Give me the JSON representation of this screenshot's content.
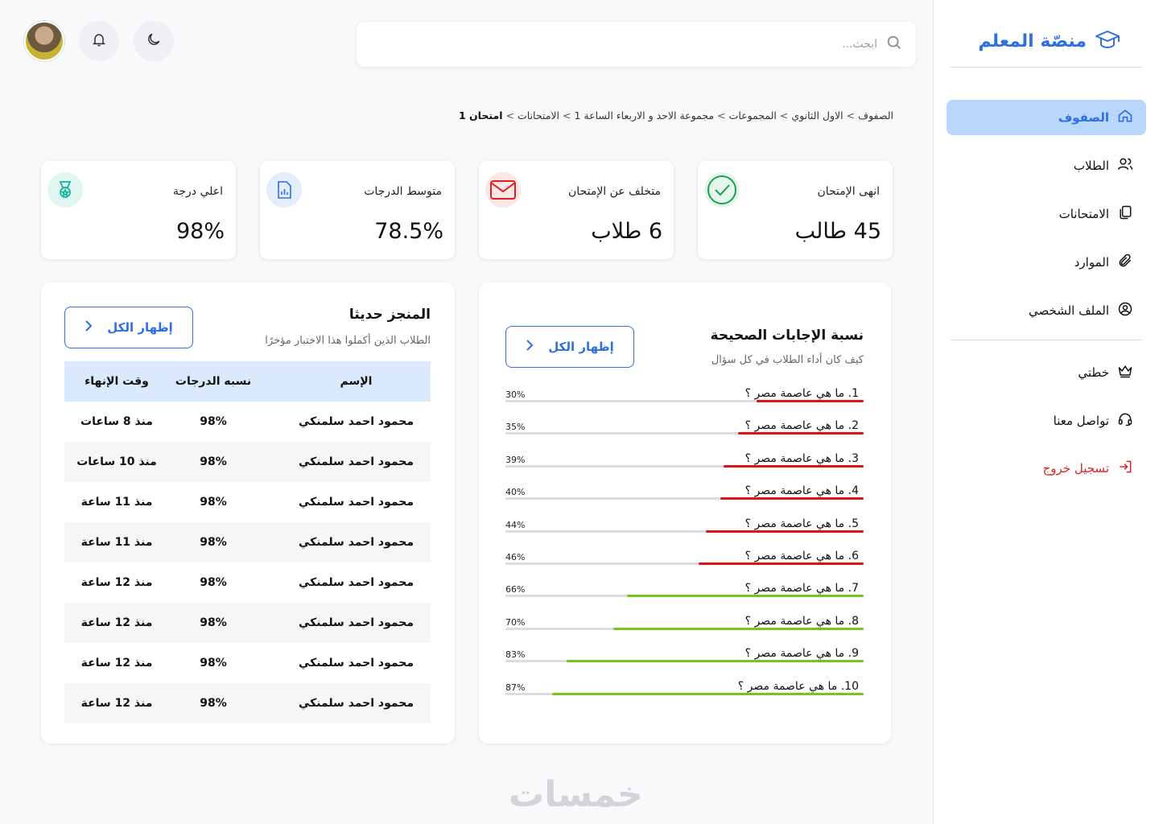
{
  "brand": {
    "title": "منصّة المعلم"
  },
  "sidebar": {
    "items": [
      {
        "label": "الصفوف",
        "icon": "home-icon",
        "active": true
      },
      {
        "label": "الطلاب",
        "icon": "users-icon"
      },
      {
        "label": "الامتحانات",
        "icon": "copy-icon"
      },
      {
        "label": "الموارد",
        "icon": "paperclip-icon"
      },
      {
        "label": "الملف الشخصي",
        "icon": "user-circle-icon"
      }
    ],
    "secondary": [
      {
        "label": "خطتي",
        "icon": "crown-icon"
      },
      {
        "label": "تواصل معنا",
        "icon": "headset-icon"
      },
      {
        "label": "تسجيل خروج",
        "icon": "logout-icon",
        "color": "#e02020"
      }
    ]
  },
  "search": {
    "placeholder": "ابحث..."
  },
  "breadcrumb": {
    "items": [
      "الصفوف",
      "الاول الثانوي",
      "المجموعات",
      "مجموعة الاحد و الاربعاء الساعة 1",
      "الامتحانات"
    ],
    "current": "امتحان 1",
    "separator": ">"
  },
  "stats": [
    {
      "label": "انهى الإمتحان",
      "value": "45 طالب",
      "icon": "check-circle-icon",
      "color": "#1aa34a",
      "bg": "#e5f7ec"
    },
    {
      "label": "متخلف عن الإمتحان",
      "value": "6 طلاب",
      "icon": "mail-icon",
      "color": "#e02020",
      "bg": "#fde6e6"
    },
    {
      "label": "متوسط الدرجات",
      "value": "78.5%",
      "icon": "report-icon",
      "color": "#2f6fe0",
      "bg": "#e3edfc"
    },
    {
      "label": "اعلي درجة",
      "value": "98%",
      "icon": "medal-icon",
      "color": "#16b39a",
      "bg": "#dff6f1"
    }
  ],
  "correct_answers": {
    "title": "نسبة الإجابات الصحيحة",
    "subtitle": "كيف كان أداء الطلاب في كل سؤال",
    "show_all": "إظهار الكل",
    "questions": [
      {
        "label": "1.  ما هي عاصمة مصر ؟",
        "pct_label": "30%",
        "pct": 30,
        "color": "#e01010"
      },
      {
        "label": "2.  ما هي عاصمة مصر ؟",
        "pct_label": "35%",
        "pct": 35,
        "color": "#e01010"
      },
      {
        "label": "3.  ما هي عاصمة مصر ؟",
        "pct_label": "39%",
        "pct": 39,
        "color": "#e01010"
      },
      {
        "label": "4.  ما هي عاصمة مصر ؟",
        "pct_label": "40%",
        "pct": 40,
        "color": "#e01010"
      },
      {
        "label": "5.  ما هي عاصمة مصر ؟",
        "pct_label": "44%",
        "pct": 44,
        "color": "#e01010"
      },
      {
        "label": "6.  ما هي عاصمة مصر ؟",
        "pct_label": "46%",
        "pct": 46,
        "color": "#e01010"
      },
      {
        "label": "7.  ما هي عاصمة مصر ؟",
        "pct_label": "66%",
        "pct": 66,
        "color": "#7ac41a"
      },
      {
        "label": "8.  ما هي عاصمة مصر ؟",
        "pct_label": "70%",
        "pct": 70,
        "color": "#7ac41a"
      },
      {
        "label": "9.  ما هي عاصمة مصر ؟",
        "pct_label": "83%",
        "pct": 83,
        "color": "#7ac41a"
      },
      {
        "label": "10. ما هي عاصمة مصر ؟",
        "pct_label": "87%",
        "pct": 87,
        "color": "#7ac41a"
      }
    ]
  },
  "recent": {
    "title": "المنجز حديثا",
    "subtitle": "الطلاب الذين أكملوا هذا الاختبار مؤخرًا",
    "show_all": "إظهار الكل",
    "columns": [
      "الإسم",
      "نسبه الدرجات",
      "وقت الإنهاء"
    ],
    "rows": [
      [
        "محمود احمد  سلمنكي",
        "98%",
        "منذ 8 ساعات"
      ],
      [
        "محمود احمد سلمنكي",
        "98%",
        "منذ 10 ساعات"
      ],
      [
        "محمود احمد سلمنكي",
        "98%",
        "منذ 11 ساعة"
      ],
      [
        "محمود احمد سلمنكي",
        "98%",
        "منذ 11 ساعة"
      ],
      [
        "محمود احمد سلمنكي",
        "98%",
        "منذ 12 ساعة"
      ],
      [
        "محمود احمد سلمنكي",
        "98%",
        "منذ 12 ساعة"
      ],
      [
        "محمود احمد سلمنكي",
        "98%",
        "منذ 12 ساعة"
      ],
      [
        "محمود احمد سلمنكي",
        "98%",
        "منذ 12 ساعة"
      ]
    ]
  },
  "watermark": "خمسات"
}
